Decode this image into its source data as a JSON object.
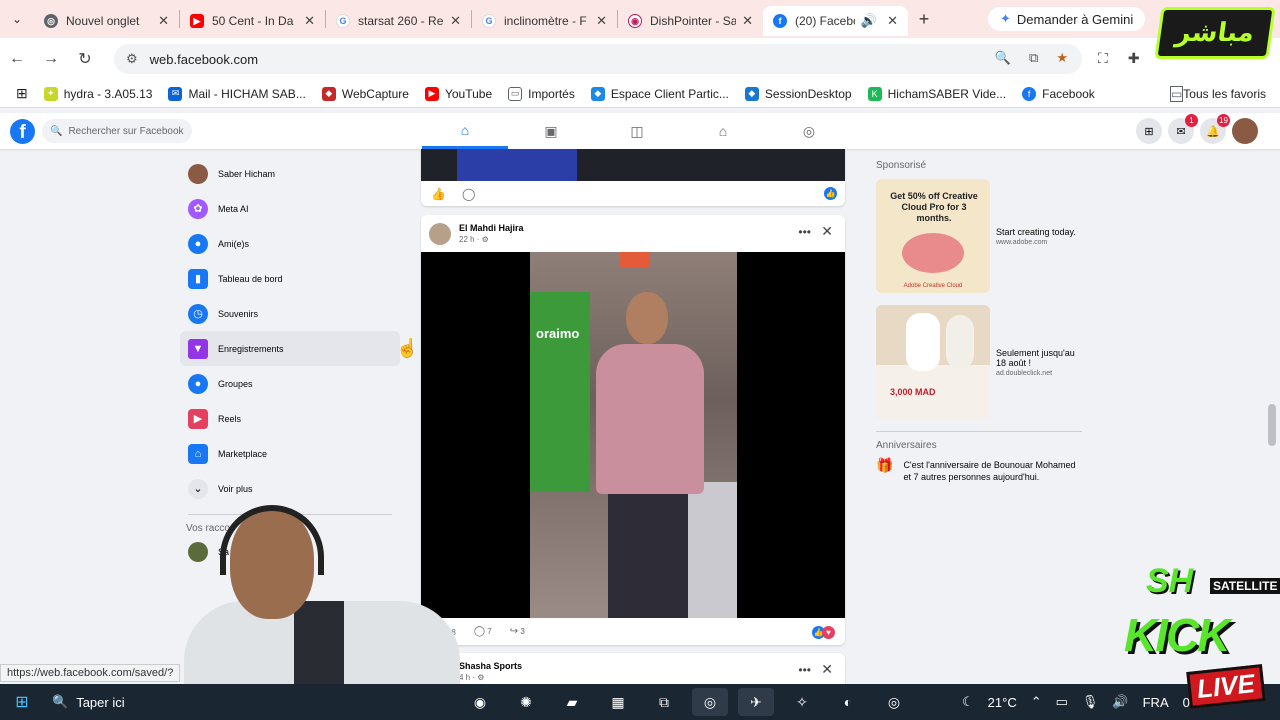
{
  "browser": {
    "tabs": [
      {
        "title": "Nouvel onglet",
        "color": "#5f6368",
        "glyph": "◎"
      },
      {
        "title": "50 Cent - In Da",
        "color": "#ff0000",
        "glyph": "▶"
      },
      {
        "title": "starsat 260 - Re",
        "color": "#4285f4",
        "glyph": "G"
      },
      {
        "title": "inclinomètre - F",
        "color": "#4285f4",
        "glyph": "G"
      },
      {
        "title": "DishPointer - Sa",
        "color": "#c2185b",
        "glyph": "◉"
      },
      {
        "title": "(20) Faceboo",
        "color": "#1877f2",
        "glyph": "f"
      }
    ],
    "new_tab": "+",
    "gemini_label": "Demander à Gemini",
    "url": "web.facebook.com",
    "bookmarks": [
      {
        "label": "hydra - 3.A05.13",
        "color": "#c7d82a",
        "glyph": "✦"
      },
      {
        "label": "Mail - HICHAM SAB...",
        "color": "#0a64d8",
        "glyph": "✉"
      },
      {
        "label": "WebCapture",
        "color": "#c62828",
        "glyph": "◆"
      },
      {
        "label": "YouTube",
        "color": "#ff0000",
        "glyph": "▶"
      },
      {
        "label": "Importés",
        "color": "#5f6368",
        "glyph": "▭"
      },
      {
        "label": "Espace Client Partic...",
        "color": "#1e88e5",
        "glyph": "◆"
      },
      {
        "label": "SessionDesktop",
        "color": "#1976d2",
        "glyph": "◆"
      },
      {
        "label": "HichamSABER Vide...",
        "color": "#1db954",
        "glyph": "K"
      },
      {
        "label": "Facebook",
        "color": "#1877f2",
        "glyph": "f"
      }
    ],
    "all_bookmarks": "Tous les favoris",
    "status_url": "https://web.facebook.com/saved/?"
  },
  "facebook": {
    "search_placeholder": "Rechercher sur Facebook",
    "notifications": {
      "messenger": "1",
      "bell": "19"
    },
    "sidebar": [
      {
        "label": "Saber Hicham",
        "icon": "profile-avatar",
        "color": "#8a5a44",
        "glyph": "●"
      },
      {
        "label": "Meta AI",
        "icon": "meta-ai-icon",
        "color": "#a259ff",
        "glyph": "✿"
      },
      {
        "label": "Ami(e)s",
        "icon": "friends-icon",
        "color": "#1877f2",
        "glyph": "👥"
      },
      {
        "label": "Tableau de bord",
        "icon": "dashboard-icon",
        "color": "#1877f2",
        "glyph": "▮"
      },
      {
        "label": "Souvenirs",
        "icon": "memories-icon",
        "color": "#1877f2",
        "glyph": "◷"
      },
      {
        "label": "Enregistrements",
        "icon": "saved-icon",
        "color": "#9334e6",
        "glyph": "▼"
      },
      {
        "label": "Groupes",
        "icon": "groups-icon",
        "color": "#1877f2",
        "glyph": "●"
      },
      {
        "label": "Reels",
        "icon": "reels-icon",
        "color": "#e4405f",
        "glyph": "▶"
      },
      {
        "label": "Marketplace",
        "icon": "marketplace-icon",
        "color": "#1877f2",
        "glyph": "⌂"
      },
      {
        "label": "Voir plus",
        "icon": "chevron-down-icon",
        "color": "#e4e6eb",
        "glyph": "⌄"
      }
    ],
    "shortcuts_heading": "Vos racco",
    "shortcut_item": "Sa",
    "posts": [
      {
        "author": "El Mahdi Hajira",
        "time": "22 h · ⚙",
        "likes": "48",
        "comments": "7",
        "shares": "3",
        "video_text": "oraimo"
      },
      {
        "author": "Shasha Sports",
        "time": "4 h · ⚙"
      }
    ],
    "right": {
      "sponsored_heading": "Sponsorisé",
      "ads": [
        {
          "image_text": "Get 50% off Creative Cloud Pro for 3 months.",
          "image_brand": "Adobe Creative Cloud",
          "title": "Start creating today.",
          "domain": "www.adobe.com"
        },
        {
          "image_price": "3,000 MAD",
          "title": "Seulement jusqu'au 18 août !",
          "domain": "ad.doubleclick.net"
        }
      ],
      "birthdays_heading": "Anniversaires",
      "birthday_text": "C'est l'anniversaire de Bounouar Mohamed et 7 autres personnes aujourd'hui."
    }
  },
  "taskbar": {
    "search_placeholder": "Taper ici",
    "weather": "21°C",
    "language": "FRA",
    "clock_partial": "0"
  },
  "overlays": {
    "stream_logo_text": "مباشر",
    "kick_brand": "SH",
    "kick_sat": "SATELLITE",
    "kick_word": "KICK",
    "kick_live": "LIVE"
  }
}
